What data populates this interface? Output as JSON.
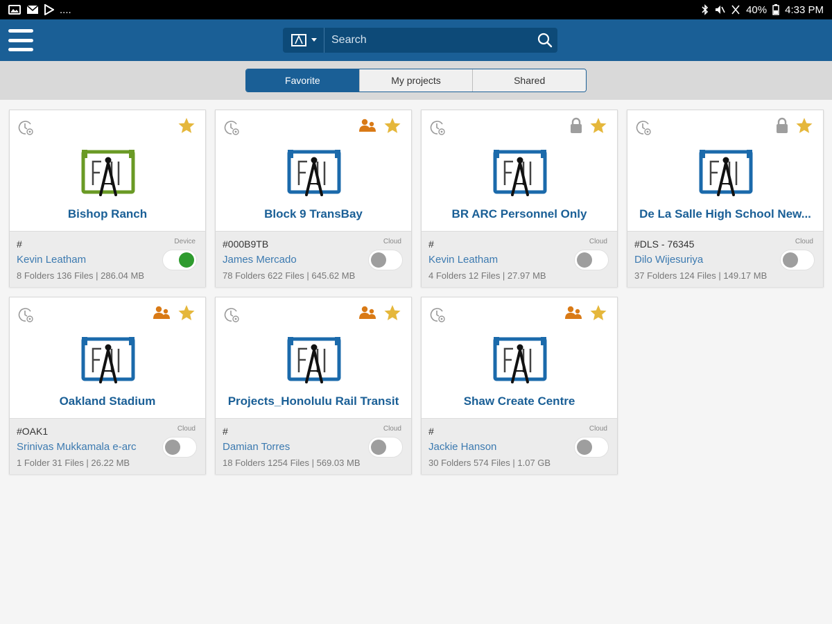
{
  "status_bar": {
    "battery": "40%",
    "time": "4:33 PM",
    "left_icons": [
      "image-icon",
      "mail-icon",
      "play-store-icon"
    ],
    "overflow": "...."
  },
  "header": {
    "search": {
      "placeholder": "Search"
    }
  },
  "tabs": [
    {
      "label": "Favorite",
      "active": true
    },
    {
      "label": "My projects",
      "active": false
    },
    {
      "label": "Shared",
      "active": false
    }
  ],
  "colors": {
    "brand": "#1a5f96",
    "logo_green": "#6a9a25",
    "logo_blue": "#1b6aab",
    "star": "#e5b73b",
    "shared_orange": "#d97a16",
    "toggle_on": "#2e9b2e"
  },
  "projects": [
    {
      "title": "Bishop Ranch",
      "code": "#",
      "owner": "Kevin Leatham",
      "meta": "8 Folders 136 Files | 286.04 MB",
      "storage": "Device",
      "synced": true,
      "shared": false,
      "locked": false,
      "favorite": true,
      "logo_color": "green"
    },
    {
      "title": "Block 9 TransBay",
      "code": "#000B9TB",
      "owner": "James Mercado",
      "meta": "78 Folders 622 Files | 645.62 MB",
      "storage": "Cloud",
      "synced": false,
      "shared": true,
      "locked": false,
      "favorite": true,
      "logo_color": "blue"
    },
    {
      "title": "BR ARC Personnel Only",
      "code": "#",
      "owner": "Kevin Leatham",
      "meta": "4 Folders 12 Files | 27.97 MB",
      "storage": "Cloud",
      "synced": false,
      "shared": false,
      "locked": true,
      "favorite": true,
      "logo_color": "blue"
    },
    {
      "title": "De La Salle High School New...",
      "code": "#DLS - 76345",
      "owner": "Dilo Wijesuriya",
      "meta": "37 Folders 124 Files | 149.17 MB",
      "storage": "Cloud",
      "synced": false,
      "shared": false,
      "locked": true,
      "favorite": true,
      "logo_color": "blue"
    },
    {
      "title": "Oakland Stadium",
      "code": "#OAK1",
      "owner": "Srinivas Mukkamala e-arc",
      "meta": "1 Folder 31 Files | 26.22 MB",
      "storage": "Cloud",
      "synced": false,
      "shared": true,
      "locked": false,
      "favorite": true,
      "logo_color": "blue"
    },
    {
      "title": "Projects_Honolulu Rail Transit",
      "code": "#",
      "owner": "Damian Torres",
      "meta": "18 Folders 1254 Files | 569.03 MB",
      "storage": "Cloud",
      "synced": false,
      "shared": true,
      "locked": false,
      "favorite": true,
      "logo_color": "blue"
    },
    {
      "title": "Shaw Create Centre",
      "code": "#",
      "owner": "Jackie Hanson",
      "meta": "30 Folders 574 Files | 1.07 GB",
      "storage": "Cloud",
      "synced": false,
      "shared": true,
      "locked": false,
      "favorite": true,
      "logo_color": "blue"
    }
  ]
}
